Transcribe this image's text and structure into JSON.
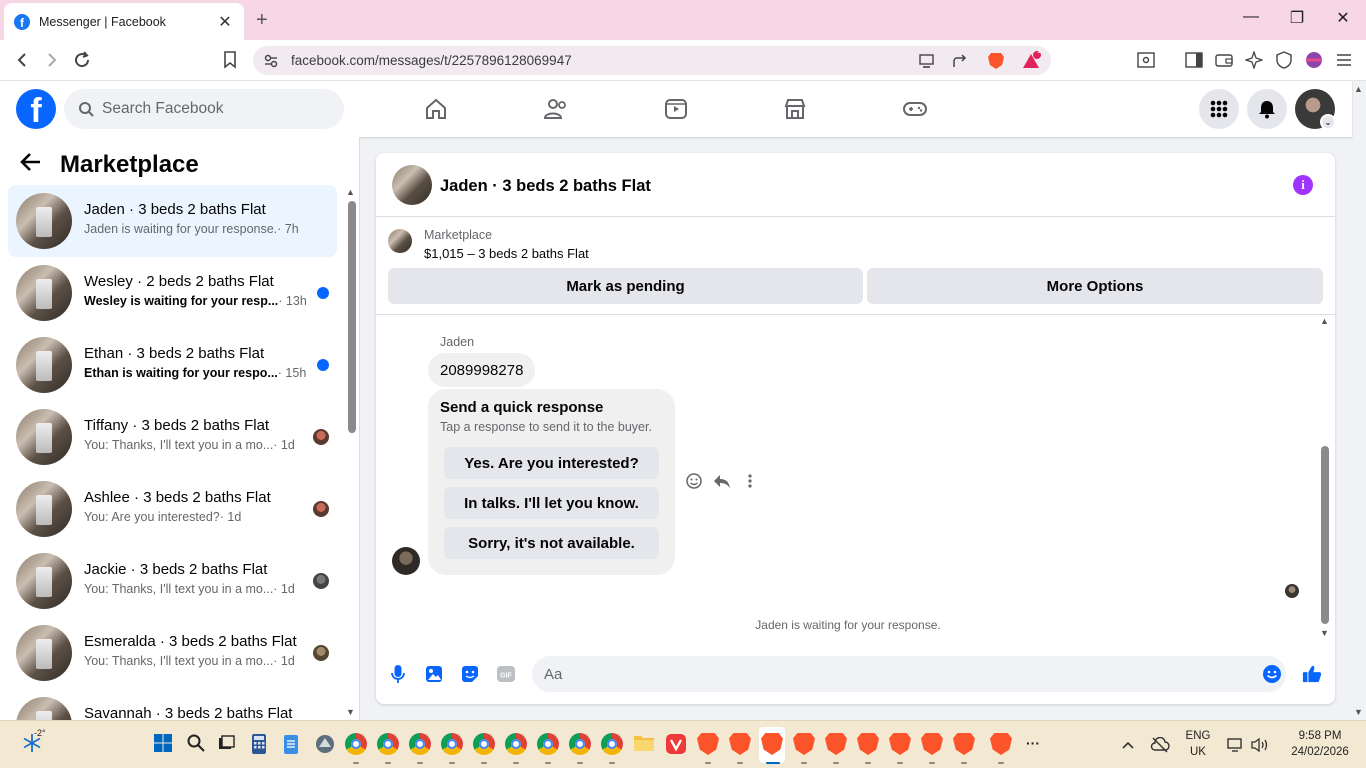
{
  "browser": {
    "tab_title": "Messenger | Facebook",
    "tab_close": "✕",
    "new_tab": "+",
    "url": "facebook.com/messages/t/2257896128069947",
    "brave_badge_count": "1",
    "window_controls": {
      "minimize": "—",
      "maximize": "❐",
      "close": "✕"
    }
  },
  "facebook": {
    "logo": "f",
    "search_placeholder": "Search Facebook",
    "nav": [
      "home-icon",
      "friends-icon",
      "watch-icon",
      "marketplace-icon",
      "gaming-icon"
    ],
    "brand_color": "#0866ff"
  },
  "sidebar": {
    "title": "Marketplace",
    "conversations": [
      {
        "name": "Jaden · 3 beds 2 baths Flat",
        "snippet": "Jaden is waiting for your response.",
        "time": "· 7h",
        "unread": false,
        "active": true
      },
      {
        "name": "Wesley · 2 beds 2 baths Flat",
        "snippet": "Wesley is waiting for your resp...",
        "time": "· 13h",
        "unread": true
      },
      {
        "name": "Ethan · 3 beds 2 baths Flat",
        "snippet": "Ethan is waiting for your respo...",
        "time": "· 15h",
        "unread": true
      },
      {
        "name": "Tiffany · 3 beds 2 baths Flat",
        "snippet": "You: Thanks, I'll text you in a mo...",
        "time": "· 1d",
        "unread": false
      },
      {
        "name": "Ashlee · 3 beds 2 baths Flat",
        "snippet": "You: Are you interested?",
        "time": "· 1d",
        "unread": false
      },
      {
        "name": "Jackie · 3 beds 2 baths Flat",
        "snippet": "You: Thanks, I'll text you in a mo...",
        "time": "· 1d",
        "unread": false
      },
      {
        "name": "Esmeralda · 3 beds 2 baths Flat",
        "snippet": "You: Thanks, I'll text you in a mo...",
        "time": "· 1d",
        "unread": false
      },
      {
        "name": "Savannah · 3 beds 2 baths Flat",
        "snippet": "",
        "time": "",
        "unread": false
      }
    ]
  },
  "chat": {
    "title": "Jaden · 3 beds 2 baths Flat",
    "info_label": "i",
    "marketplace_label": "Marketplace",
    "listing": "$1,015 – 3 beds 2 baths Flat",
    "mark_pending": "Mark as pending",
    "more_options": "More Options",
    "sender": "Jaden",
    "phone_message": "2089998278",
    "quick_response_title": "Send a quick response",
    "quick_response_sub": "Tap a response to send it to the buyer.",
    "quick_responses": [
      "Yes. Are you interested?",
      "In talks. I'll let you know.",
      "Sorry, it's not available."
    ],
    "waiting_text": "Jaden is waiting for your response.",
    "composer_placeholder": "Aa",
    "gif_label": "GIF"
  },
  "taskbar": {
    "weather_temp": "-2°",
    "language": "ENG",
    "region": "UK",
    "time": "9:58 PM",
    "date": "24/02/2026",
    "more": "···"
  }
}
